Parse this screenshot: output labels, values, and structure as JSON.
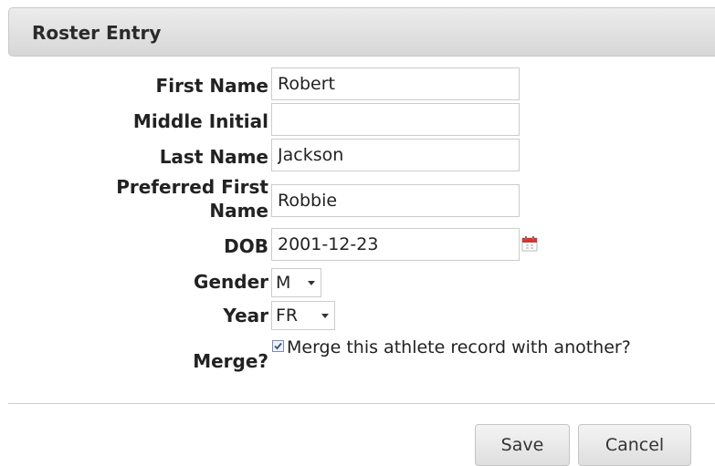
{
  "dialog": {
    "title": "Roster Entry"
  },
  "form": {
    "first_name": {
      "label": "First Name",
      "value": "Robert"
    },
    "middle_initial": {
      "label": "Middle Initial",
      "value": ""
    },
    "last_name": {
      "label": "Last Name",
      "value": "Jackson"
    },
    "preferred_first_name": {
      "label": "Preferred First Name",
      "value": "Robbie"
    },
    "dob": {
      "label": "DOB",
      "value": "2001-12-23",
      "icon": "calendar-icon"
    },
    "gender": {
      "label": "Gender",
      "selected": "M"
    },
    "year": {
      "label": "Year",
      "selected": "FR"
    },
    "merge": {
      "label": "Merge?",
      "checkbox_label": "Merge this athlete record with another?",
      "checked": true
    }
  },
  "buttons": {
    "save": "Save",
    "cancel": "Cancel"
  },
  "colors": {
    "header_gradient_top": "#ececec",
    "header_gradient_bottom": "#d7d7d7",
    "calendar_red": "#d9342b"
  }
}
